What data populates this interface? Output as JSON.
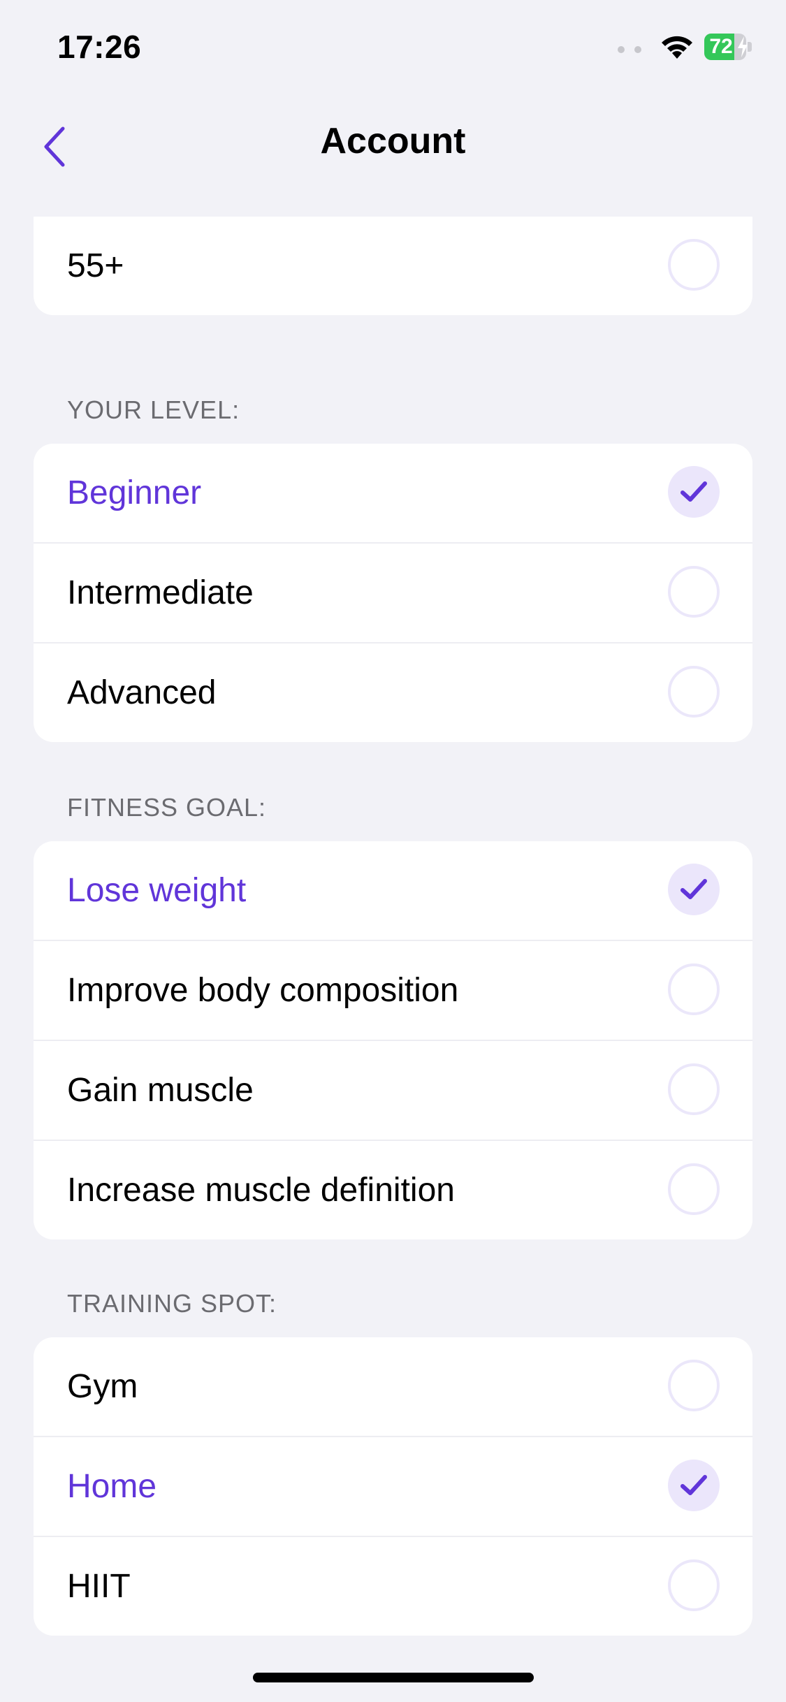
{
  "status_bar": {
    "time": "17:26",
    "battery_percent": "72",
    "battery_level": 0.72
  },
  "nav": {
    "title": "Account",
    "back_icon": "chevron-left-icon"
  },
  "age": {
    "options": [
      {
        "label": "55+",
        "selected": false
      }
    ]
  },
  "level": {
    "header": "YOUR LEVEL:",
    "options": [
      {
        "label": "Beginner",
        "selected": true
      },
      {
        "label": "Intermediate",
        "selected": false
      },
      {
        "label": "Advanced",
        "selected": false
      }
    ]
  },
  "goal": {
    "header": "FITNESS GOAL:",
    "options": [
      {
        "label": "Lose weight",
        "selected": true
      },
      {
        "label": "Improve body composition",
        "selected": false
      },
      {
        "label": "Gain muscle",
        "selected": false
      },
      {
        "label": "Increase muscle definition",
        "selected": false
      }
    ]
  },
  "spot": {
    "header": "TRAINING SPOT:",
    "options": [
      {
        "label": "Gym",
        "selected": false
      },
      {
        "label": "Home",
        "selected": true
      },
      {
        "label": "HIIT",
        "selected": false
      }
    ]
  },
  "colors": {
    "accent": "#6035d9",
    "accent_light": "#ebe6fb",
    "background": "#f2f2f7",
    "battery": "#34c759"
  }
}
